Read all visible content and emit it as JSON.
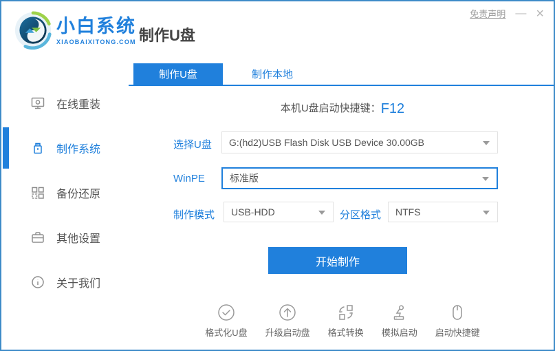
{
  "colors": {
    "primary": "#2080dc",
    "window_border": "#3e8bc8",
    "icon_gray": "#8f8f8f"
  },
  "window": {
    "disclaimer": "免责声明",
    "minimize": "—",
    "close": "×"
  },
  "header": {
    "brand": "小白系统",
    "brand_domain": "XIAOBAIXITONG.COM",
    "page_title": "制作U盘"
  },
  "sidebar": {
    "items": [
      {
        "label": "在线重装",
        "icon": "monitor-reinstall-icon",
        "active": false
      },
      {
        "label": "制作系统",
        "icon": "usb-drive-icon",
        "active": true
      },
      {
        "label": "备份还原",
        "icon": "backup-grid-icon",
        "active": false
      },
      {
        "label": "其他设置",
        "icon": "briefcase-settings-icon",
        "active": false
      },
      {
        "label": "关于我们",
        "icon": "info-circle-icon",
        "active": false
      }
    ]
  },
  "tabs": [
    {
      "label": "制作U盘",
      "active": true
    },
    {
      "label": "制作本地",
      "active": false
    }
  ],
  "main": {
    "hotkey_label": "本机U盘启动快捷键：",
    "hotkey_value": "F12",
    "fields": {
      "usb_label": "选择U盘",
      "usb_value": "G:(hd2)USB Flash Disk USB Device 30.00GB",
      "winpe_label": "WinPE",
      "winpe_value": "标准版",
      "mode_label": "制作模式",
      "mode_value": "USB-HDD",
      "partition_label": "分区格式",
      "partition_value": "NTFS"
    },
    "start_button": "开始制作",
    "utilities": [
      {
        "label": "格式化U盘",
        "icon": "check-circle-icon"
      },
      {
        "label": "升级启动盘",
        "icon": "arrow-up-circle-icon"
      },
      {
        "label": "格式转换",
        "icon": "convert-squares-icon"
      },
      {
        "label": "模拟启动",
        "icon": "joystick-icon"
      },
      {
        "label": "启动快捷键",
        "icon": "mouse-icon"
      }
    ]
  }
}
